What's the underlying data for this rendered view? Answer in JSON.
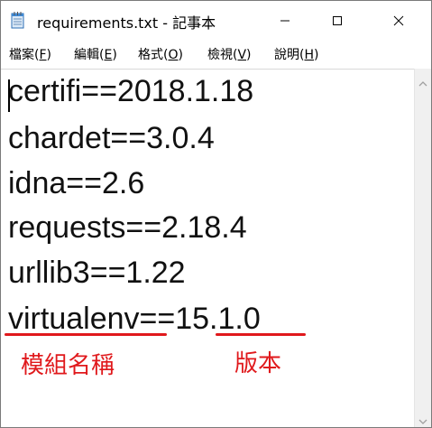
{
  "window": {
    "title": "requirements.txt - 記事本"
  },
  "menu": {
    "file": {
      "label": "檔案(",
      "key": "F",
      "end": ")"
    },
    "edit": {
      "label": "編輯(",
      "key": "E",
      "end": ")"
    },
    "format": {
      "label": "格式(",
      "key": "O",
      "end": ")"
    },
    "view": {
      "label": "檢視(",
      "key": "V",
      "end": ")"
    },
    "help": {
      "label": "說明(",
      "key": "H",
      "end": ")"
    }
  },
  "editor": {
    "lines": [
      "certifi==2018.1.18",
      "chardet==3.0.4",
      "idna==2.6",
      "requests==2.18.4",
      "urllib3==1.22",
      "virtualenv==15.1.0"
    ]
  },
  "annotations": {
    "module_name": "模組名稱",
    "version": "版本",
    "color": "#e0191c"
  },
  "icons": {
    "app": "notepad-icon",
    "minimize": "minimize-icon",
    "maximize": "maximize-icon",
    "close": "close-icon"
  }
}
